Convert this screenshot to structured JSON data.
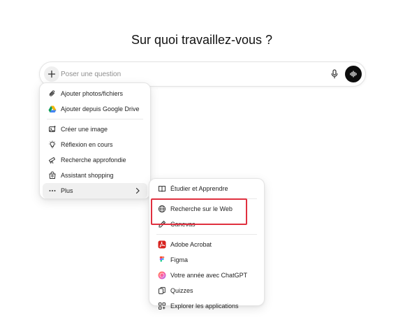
{
  "heading": "Sur quoi travaillez-vous ?",
  "composer": {
    "placeholder": "Poser une question",
    "plus_icon": "plus-icon",
    "mic_icon": "microphone-icon",
    "voice_icon": "voice-mode-icon"
  },
  "main_menu": {
    "items": [
      {
        "label": "Ajouter photos/fichiers",
        "icon": "paperclip-icon"
      },
      {
        "label": "Ajouter depuis Google Drive",
        "icon": "google-drive-icon"
      },
      {
        "label": "Créer une image",
        "icon": "image-create-icon"
      },
      {
        "label": "Réflexion en cours",
        "icon": "lightbulb-icon"
      },
      {
        "label": "Recherche approfondie",
        "icon": "telescope-icon"
      },
      {
        "label": "Assistant shopping",
        "icon": "shopping-bag-icon"
      },
      {
        "label": "Plus",
        "icon": "more-dots-icon",
        "chevron": "chevron-right-icon"
      }
    ]
  },
  "sub_menu": {
    "items": [
      {
        "label": "Étudier et Apprendre",
        "icon": "book-icon"
      },
      {
        "label": "Recherche sur le Web",
        "icon": "globe-icon"
      },
      {
        "label": "Canevas",
        "icon": "pen-icon"
      },
      {
        "label": "Adobe Acrobat",
        "icon": "adobe-acrobat-icon"
      },
      {
        "label": "Figma",
        "icon": "figma-icon"
      },
      {
        "label": "Votre année avec ChatGPT",
        "icon": "year-review-icon"
      },
      {
        "label": "Quizzes",
        "icon": "quiz-cards-icon"
      },
      {
        "label": "Explorer les applications",
        "icon": "apps-grid-icon"
      }
    ]
  },
  "colors": {
    "highlight": "#e0303f",
    "acrobat": "#d7221e",
    "voice_button": "#0d0d0d"
  }
}
